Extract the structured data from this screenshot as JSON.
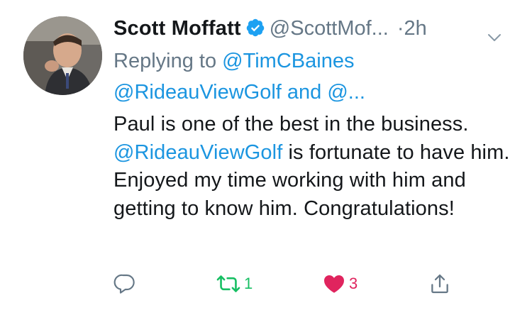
{
  "tweet": {
    "author": {
      "display_name": "Scott Moffatt",
      "handle": "@ScottMof...",
      "verified": true
    },
    "separator": "·",
    "timestamp": "2h",
    "reply_context": {
      "prefix": "Replying to",
      "first_mention": "@TimCBaines",
      "second_line": "@RideauViewGolf and @..."
    },
    "text": {
      "part1": "Paul is one of the best in the business. ",
      "mention": "@RideauViewGolf",
      "part2": " is fortunate to have him. Enjoyed my time working with him and getting to know him. Congratulations!"
    },
    "actions": {
      "reply_count": "",
      "retweet_count": "1",
      "like_count": "3"
    }
  },
  "colors": {
    "accent": "#1b95e0",
    "muted": "#657786",
    "retweet": "#17bf63",
    "like": "#e0245e",
    "text": "#14171a"
  },
  "icons": {
    "verified": "verified-badge-icon",
    "menu": "chevron-down-icon",
    "reply": "reply-icon",
    "retweet": "retweet-icon",
    "like": "heart-icon",
    "share": "share-icon"
  }
}
